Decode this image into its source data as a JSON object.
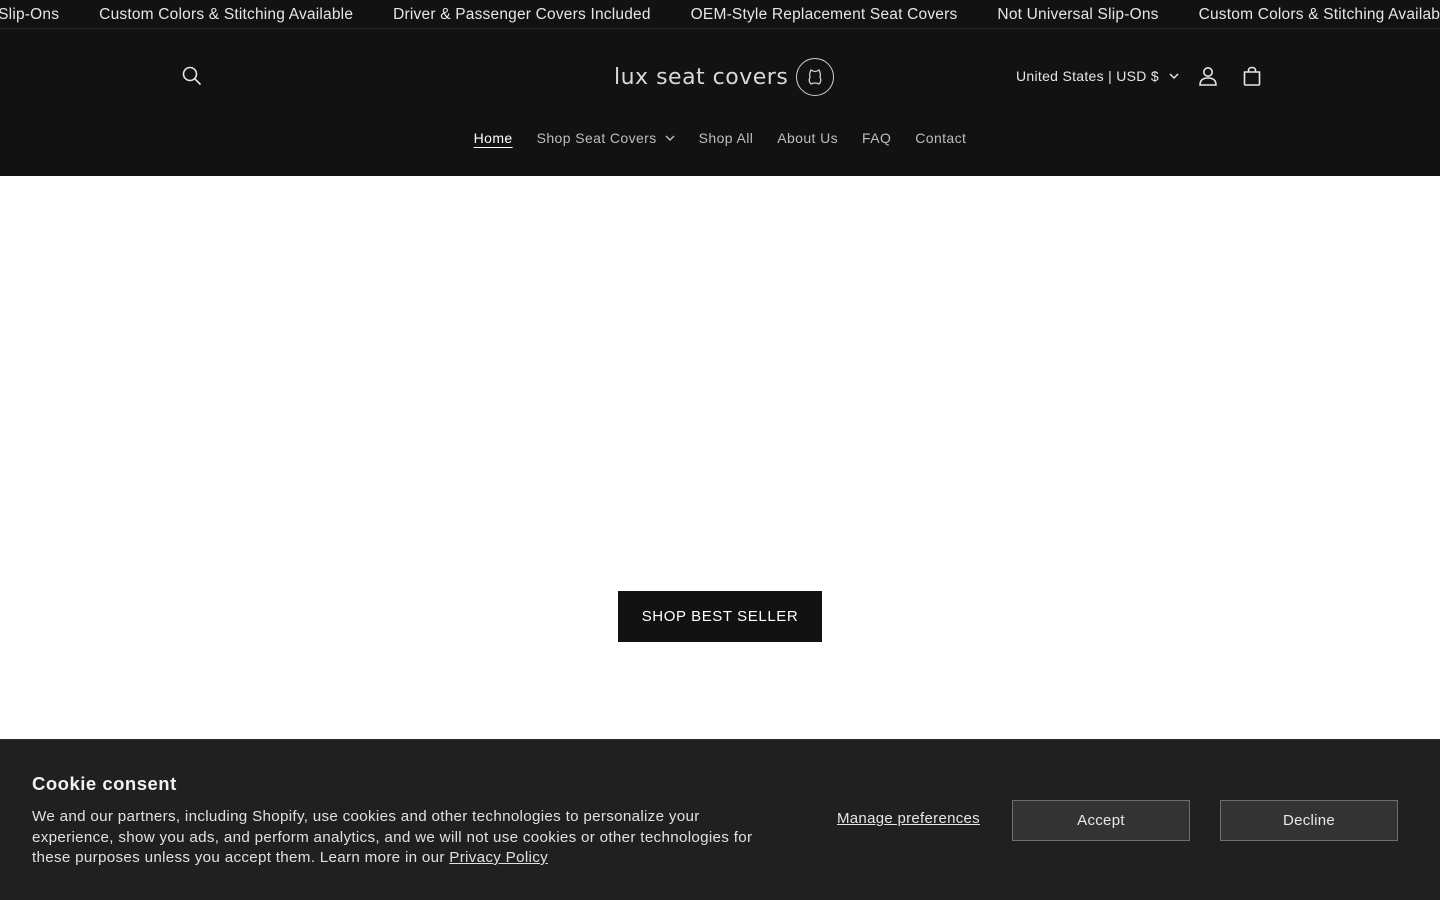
{
  "announcement": {
    "items": [
      "Not Universal Slip-Ons",
      "Custom Colors & Stitching Available",
      "Driver & Passenger Covers Included",
      "OEM-Style Replacement Seat Covers",
      "Not Universal Slip-Ons",
      "Custom Colors & Stitching Available"
    ]
  },
  "header": {
    "logo_text": "lux seat covers",
    "currency_label": "United States | USD $",
    "nav": [
      {
        "label": "Home"
      },
      {
        "label": "Shop Seat Covers"
      },
      {
        "label": "Shop All"
      },
      {
        "label": "About Us"
      },
      {
        "label": "FAQ"
      },
      {
        "label": "Contact"
      }
    ]
  },
  "hero": {
    "cta_label": "SHOP BEST SELLER"
  },
  "cookie": {
    "title": "Cookie consent",
    "body": "We and our partners, including Shopify, use cookies and other technologies to personalize your experience, show you ads, and perform analytics, and we will not use cookies or other technologies for these purposes unless you accept them. Learn more in our ",
    "privacy_link": "Privacy Policy",
    "manage_label": "Manage preferences",
    "accept_label": "Accept",
    "decline_label": "Decline"
  },
  "colors": {
    "header_bg": "#121212",
    "cookie_bg": "#202020",
    "button_bg": "#121212"
  }
}
